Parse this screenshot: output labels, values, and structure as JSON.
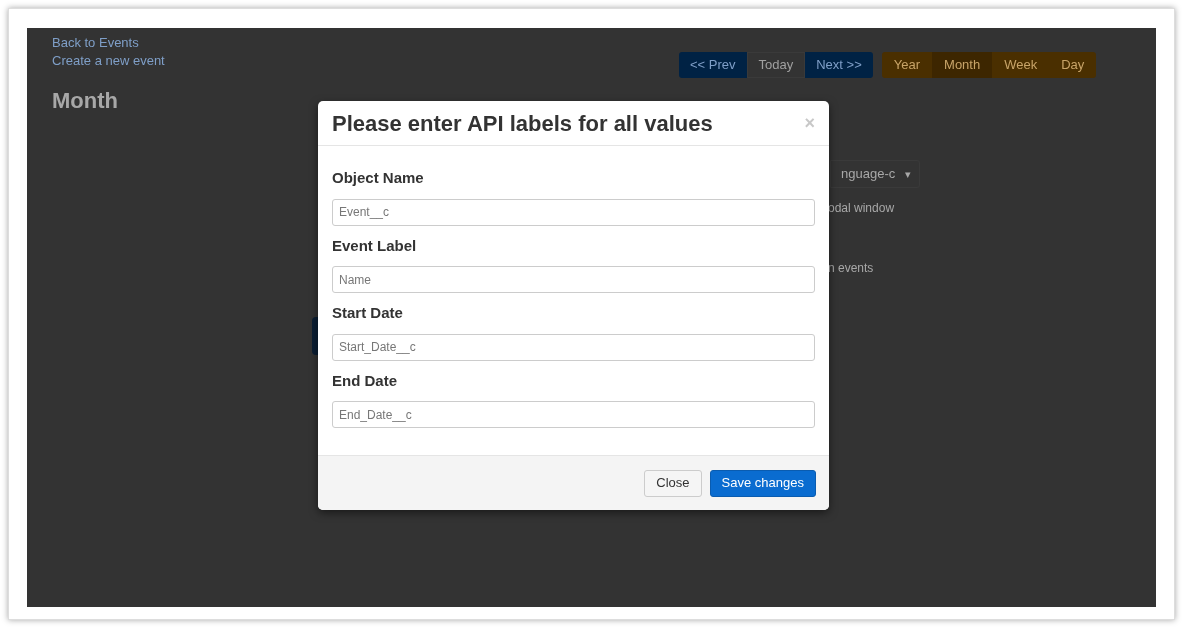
{
  "page": {
    "links": [
      "Back to Events",
      "Create a new event"
    ],
    "heading": "Month",
    "nav_buttons": [
      {
        "label": "<< Prev",
        "kind": "primary"
      },
      {
        "label": "Today",
        "kind": "default"
      },
      {
        "label": "Next >>",
        "kind": "primary"
      }
    ],
    "view_tabs": [
      {
        "label": "Year",
        "selected": false
      },
      {
        "label": "Month",
        "selected": true
      },
      {
        "label": "Week",
        "selected": false
      },
      {
        "label": "Day",
        "selected": false
      }
    ],
    "select": {
      "value": "nguage-c",
      "caret": "▾"
    },
    "texts": [
      "odal window",
      "n events"
    ]
  },
  "modal": {
    "title": "Please enter API labels for all values",
    "close": "×",
    "fields": [
      {
        "label": "Object Name",
        "placeholder": "Event__c"
      },
      {
        "label": "Event Label",
        "placeholder": "Name"
      },
      {
        "label": "Start Date",
        "placeholder": "Start_Date__c"
      },
      {
        "label": "End Date",
        "placeholder": "End_Date__c"
      }
    ],
    "buttons": [
      {
        "label": "Close",
        "kind": "default"
      },
      {
        "label": "Save changes",
        "kind": "primary"
      }
    ]
  }
}
